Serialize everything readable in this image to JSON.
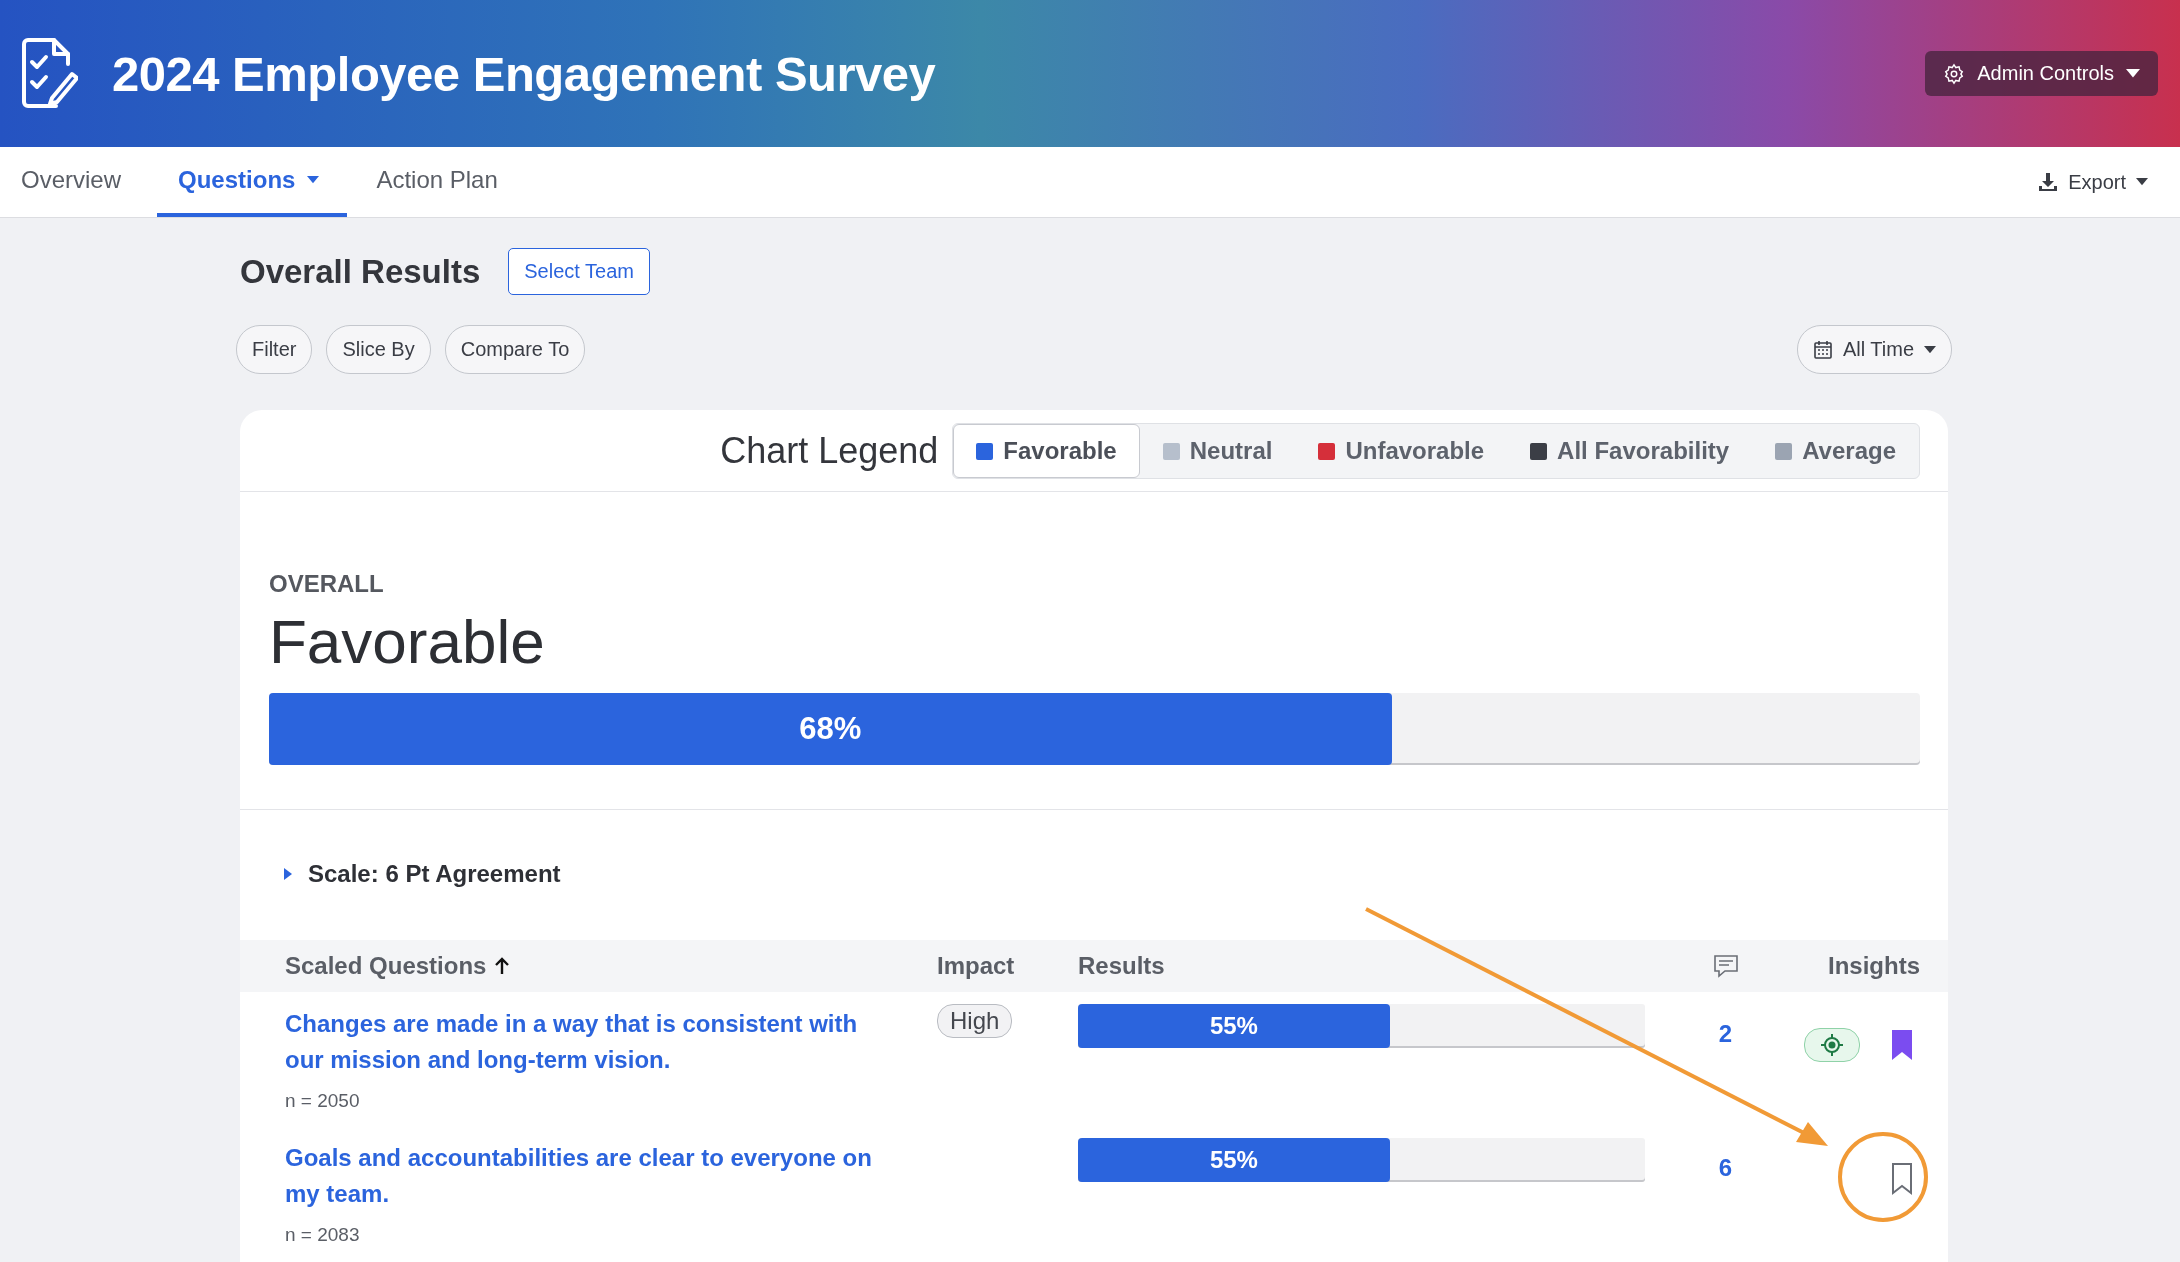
{
  "header": {
    "title": "2024 Employee Engagement Survey",
    "admin_button": "Admin Controls"
  },
  "tabs": [
    {
      "label": "Overview",
      "selected": false,
      "has_menu": false
    },
    {
      "label": "Questions",
      "selected": true,
      "has_menu": true
    },
    {
      "label": "Action Plan",
      "selected": false,
      "has_menu": false
    }
  ],
  "export_button": "Export",
  "page_title": "Overall Results",
  "select_team_button": "Select Team",
  "filters": [
    "Filter",
    "Slice By",
    "Compare To"
  ],
  "date_filter": "All Time",
  "legend": {
    "title": "Chart Legend",
    "items": [
      {
        "label": "Favorable",
        "color": "#2b64dd",
        "selected": true
      },
      {
        "label": "Neutral",
        "color": "#b6bfcc",
        "selected": false
      },
      {
        "label": "Unfavorable",
        "color": "#d52f3a",
        "selected": false
      },
      {
        "label": "All Favorability",
        "color": "#3b3e46",
        "selected": false
      },
      {
        "label": "Average",
        "color": "#9ba4b2",
        "selected": false
      }
    ]
  },
  "overall": {
    "label": "OVERALL",
    "metric": "Favorable",
    "level": 0.68,
    "reading": "68%"
  },
  "scale": {
    "label": "Scale: 6 Pt Agreement",
    "expanded": false
  },
  "table": {
    "columns": [
      "Scaled Questions",
      "Impact",
      "Results",
      "Insights"
    ],
    "rows": [
      {
        "question": "Changes are made in a way that is consistent with our mission and long-term vision.",
        "n": "n = 2050",
        "impact": "High",
        "level": 0.55,
        "reading": "55%",
        "comments": "2",
        "insight_badge": true,
        "bookmarked": true,
        "highlighted": false
      },
      {
        "question": "Goals and accountabilities are clear to everyone on my team.",
        "n": "n = 2083",
        "level": 0.55,
        "reading": "55%",
        "comments": "6",
        "insight_badge": false,
        "bookmarked": false,
        "highlighted": true
      }
    ]
  }
}
